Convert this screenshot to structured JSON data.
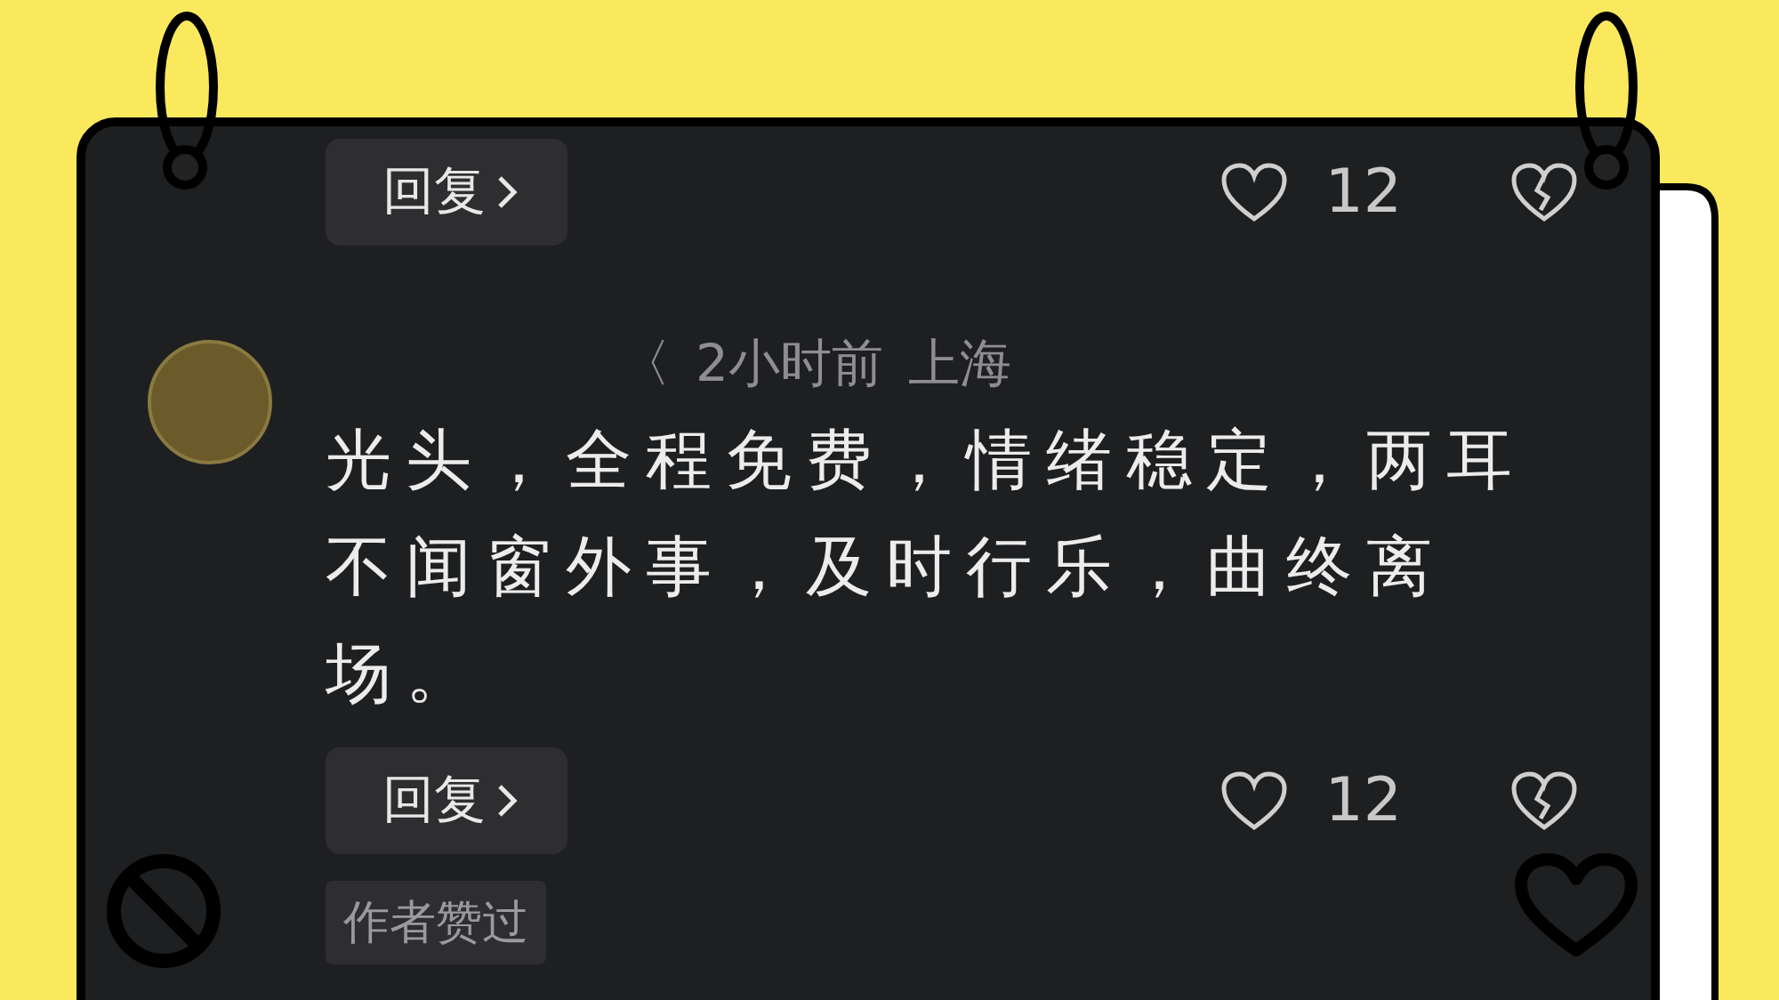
{
  "previous_comment": {
    "reply_button": "回复",
    "like_count": "12"
  },
  "comment": {
    "name_fragment": "〈",
    "time": "2小时前",
    "location": "上海",
    "text": "光头，全程免费，情绪稳定，两耳不闻窗外事，及时行乐，曲终离场。",
    "reply_button": "回复",
    "like_count": "12",
    "badge": "作者赞过"
  }
}
